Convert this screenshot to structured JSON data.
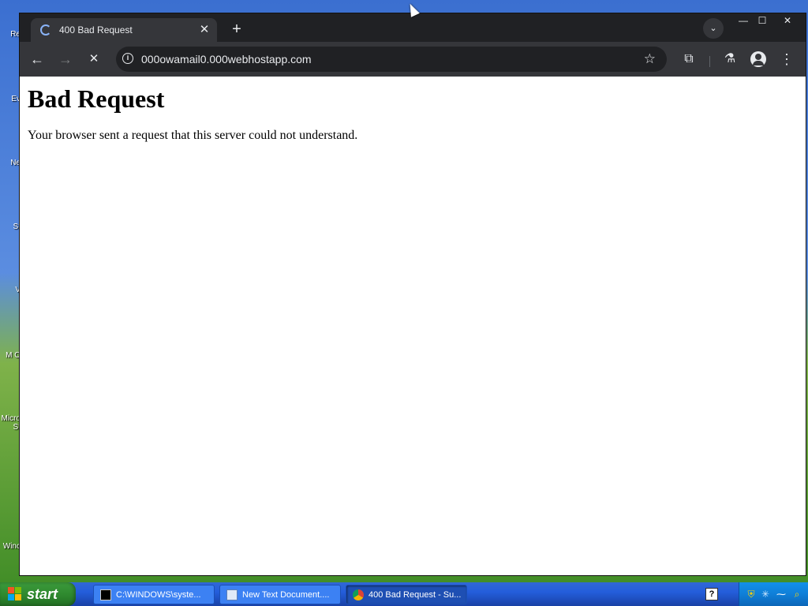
{
  "desktop": {
    "icon_labels": [
      "Re",
      "Ev",
      "Ne",
      "St",
      "V",
      "M O",
      "Micro St",
      "Winc"
    ]
  },
  "browser": {
    "tab": {
      "title": "400 Bad Request",
      "close": "✕"
    },
    "new_tab": "+",
    "tab_search": "⌄",
    "window_controls": {
      "minimize": "—",
      "maximize": "☐",
      "close": "✕"
    },
    "nav": {
      "back": "←",
      "forward": "→",
      "stop": "✕"
    },
    "omnibox": {
      "url": "000owamail0.000webhostapp.com",
      "star": "☆",
      "info": "i"
    },
    "toolbar_icons": {
      "extensions": "⧉",
      "labs": "⚗",
      "menu": "⋮"
    },
    "page": {
      "heading": "Bad Request",
      "message": "Your browser sent a request that this server could not understand."
    }
  },
  "taskbar": {
    "start_label": "start",
    "tasks": [
      {
        "label": "C:\\WINDOWS\\syste..."
      },
      {
        "label": "New Text Document...."
      },
      {
        "label": "400 Bad Request - Su..."
      }
    ],
    "help": "?"
  }
}
